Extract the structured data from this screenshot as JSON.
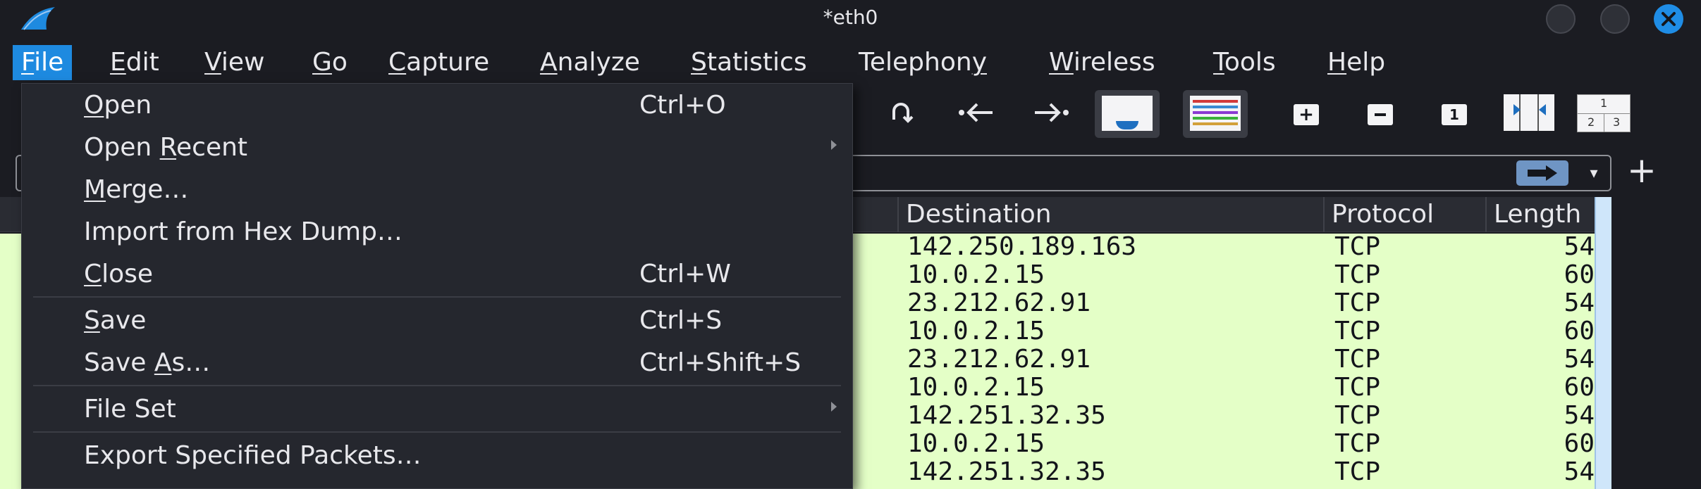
{
  "window": {
    "title": "*eth0",
    "logo_icon": "wireshark-fin-icon",
    "controls": [
      "minimize-icon",
      "maximize-icon",
      "close-icon"
    ]
  },
  "menubar": {
    "items": [
      {
        "label": "File",
        "mnemonic": "F",
        "active": true
      },
      {
        "label": "Edit",
        "mnemonic": "E"
      },
      {
        "label": "View",
        "mnemonic": "V"
      },
      {
        "label": "Go",
        "mnemonic": "G"
      },
      {
        "label": "Capture",
        "mnemonic": "C"
      },
      {
        "label": "Analyze",
        "mnemonic": "A"
      },
      {
        "label": "Statistics",
        "mnemonic": "S"
      },
      {
        "label": "Telephony",
        "mnemonic": "y"
      },
      {
        "label": "Wireless",
        "mnemonic": "W"
      },
      {
        "label": "Tools",
        "mnemonic": "T"
      },
      {
        "label": "Help",
        "mnemonic": "H"
      }
    ]
  },
  "toolbar": {
    "icons": [
      "go-to-packet-icon",
      "previous-packet-icon",
      "next-packet-icon",
      "auto-scroll-icon",
      "colorize-icon",
      "zoom-in-icon",
      "zoom-out-icon",
      "normal-size-icon",
      "resize-columns-icon",
      "layout-panes-icon"
    ],
    "layout_panes_digits": [
      "1",
      "2",
      "3"
    ]
  },
  "filter": {
    "value": "",
    "icons": [
      "apply-filter-icon",
      "filter-dropdown-icon",
      "add-filter-button-icon"
    ]
  },
  "packet_list": {
    "columns": [
      "Destination",
      "Protocol",
      "Length"
    ],
    "rows": [
      {
        "destination": "142.250.189.163",
        "protocol": "TCP",
        "length": "54"
      },
      {
        "destination": "10.0.2.15",
        "protocol": "TCP",
        "length": "60"
      },
      {
        "destination": "23.212.62.91",
        "protocol": "TCP",
        "length": "54"
      },
      {
        "destination": "10.0.2.15",
        "protocol": "TCP",
        "length": "60"
      },
      {
        "destination": "23.212.62.91",
        "protocol": "TCP",
        "length": "54"
      },
      {
        "destination": "10.0.2.15",
        "protocol": "TCP",
        "length": "60"
      },
      {
        "destination": "142.251.32.35",
        "protocol": "TCP",
        "length": "54"
      },
      {
        "destination": "10.0.2.15",
        "protocol": "TCP",
        "length": "60"
      },
      {
        "destination": "142.251.32.35",
        "protocol": "TCP",
        "length": "54"
      }
    ],
    "row_color": "#e4ffc7"
  },
  "file_menu": {
    "items": [
      {
        "label": "Open",
        "mnemonic": "O",
        "shortcut": "Ctrl+O",
        "submenu": false
      },
      {
        "label": "Open Recent",
        "mnemonic": "R",
        "shortcut": "",
        "submenu": true
      },
      {
        "label": "Merge…",
        "mnemonic": "M",
        "shortcut": "",
        "submenu": false
      },
      {
        "label": "Import from Hex Dump…",
        "mnemonic": "",
        "shortcut": "",
        "submenu": false
      },
      {
        "label": "Close",
        "mnemonic": "C",
        "shortcut": "Ctrl+W",
        "submenu": false
      },
      {
        "label": "Save",
        "mnemonic": "S",
        "shortcut": "Ctrl+S",
        "submenu": false
      },
      {
        "label": "Save As…",
        "mnemonic": "A",
        "shortcut": "Ctrl+Shift+S",
        "submenu": false
      },
      {
        "label": "File Set",
        "mnemonic": "",
        "shortcut": "",
        "submenu": true
      },
      {
        "label": "Export Specified Packets…",
        "mnemonic": "",
        "shortcut": "",
        "submenu": false
      }
    ]
  },
  "colors": {
    "accent": "#1e8ae0",
    "background": "#1b1c22",
    "menu_background": "#25272e",
    "close_button": "#1f8de6"
  }
}
